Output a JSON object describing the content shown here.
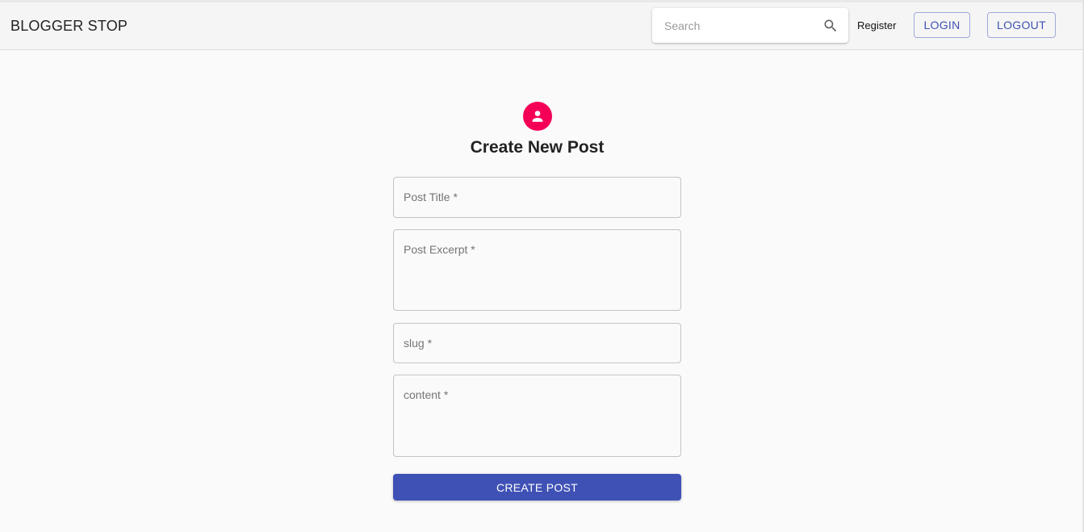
{
  "header": {
    "brand": "BLOGGER STOP",
    "search": {
      "placeholder": "Search",
      "value": "",
      "icon": "search-icon"
    },
    "register_label": "Register",
    "login_label": "LOGIN",
    "logout_label": "LOGOUT"
  },
  "form": {
    "avatar_icon": "person-icon",
    "avatar_color": "#f50057",
    "title": "Create New Post",
    "fields": [
      {
        "label": "Post Title *",
        "value": ""
      },
      {
        "label": "Post Excerpt *",
        "value": ""
      },
      {
        "label": "slug *",
        "value": ""
      },
      {
        "label": "content *",
        "value": ""
      }
    ],
    "submit_label": "CREATE POST",
    "primary_color": "#3f51b5"
  }
}
